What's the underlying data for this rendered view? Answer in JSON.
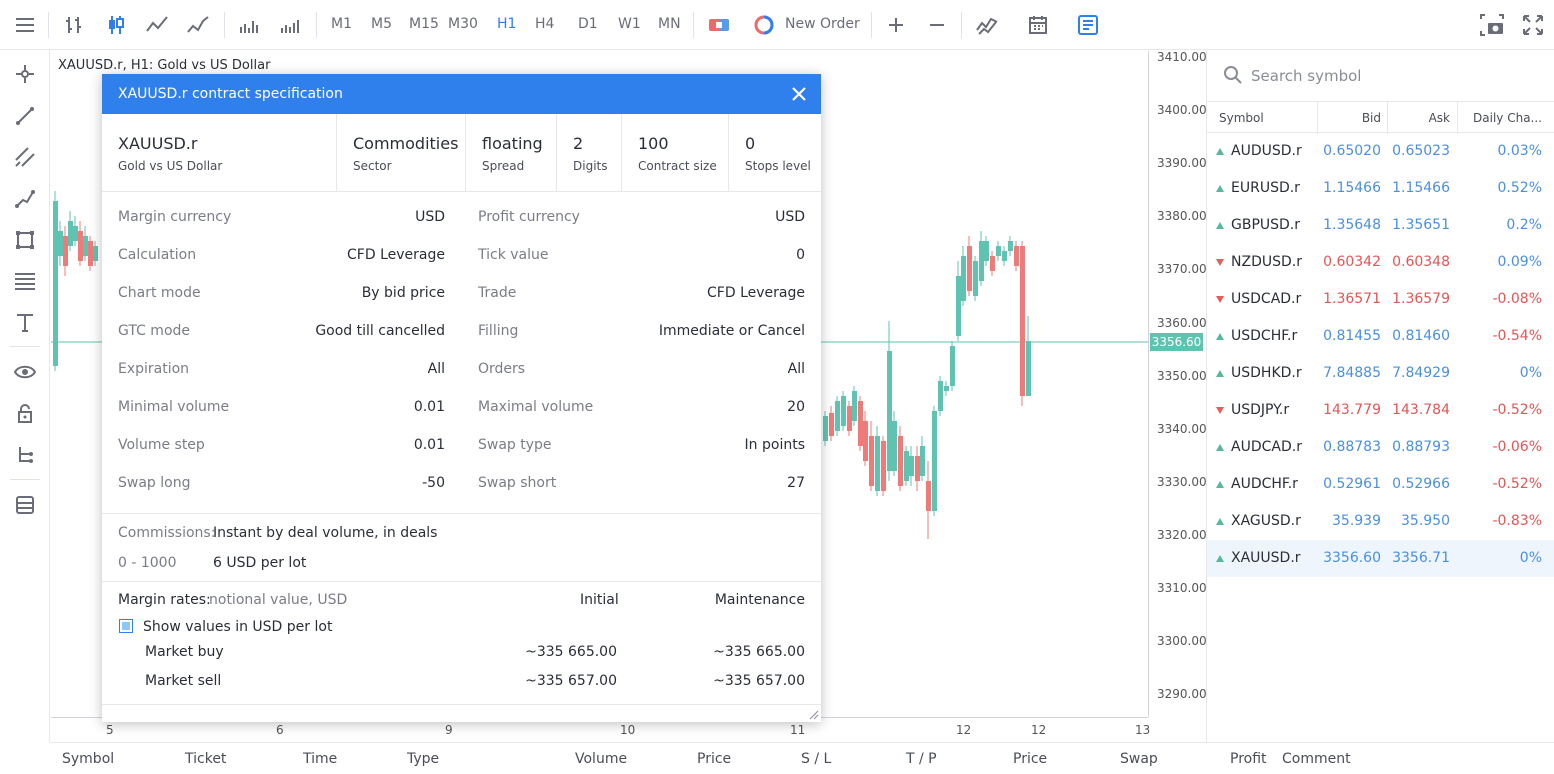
{
  "toolbar": {
    "timeframes": [
      "M1",
      "M5",
      "M15",
      "M30",
      "H1",
      "H4",
      "D1",
      "W1",
      "MN"
    ],
    "active_timeframe": "H1",
    "new_order_label": "New Order"
  },
  "chart": {
    "title": "XAUUSD.r, H1: Gold vs US Dollar",
    "price_labels": [
      "3410.00",
      "3400.00",
      "3390.00",
      "3380.00",
      "3370.00",
      "3360.00",
      "3350.00",
      "3340.00",
      "3330.00",
      "3320.00",
      "3310.00",
      "3300.00",
      "3290.00"
    ],
    "current_price": "3356.60",
    "time_labels": [
      "5",
      "6",
      "9",
      "10",
      "11",
      "12",
      "12",
      "13"
    ],
    "colors": {
      "up": "#5fc3b2",
      "down": "#ef7a7a"
    }
  },
  "symbols_panel": {
    "search_placeholder": "Search symbol",
    "columns": {
      "symbol": "Symbol",
      "bid": "Bid",
      "ask": "Ask",
      "change": "Daily Cha..."
    },
    "rows": [
      {
        "symbol": "AUDUSD.r",
        "bid": "0.65020",
        "ask": "0.65023",
        "change": "0.03%",
        "dir": "up"
      },
      {
        "symbol": "EURUSD.r",
        "bid": "1.15466",
        "ask": "1.15466",
        "change": "0.52%",
        "dir": "up"
      },
      {
        "symbol": "GBPUSD.r",
        "bid": "1.35648",
        "ask": "1.35651",
        "change": "0.2%",
        "dir": "up"
      },
      {
        "symbol": "NZDUSD.r",
        "bid": "0.60342",
        "ask": "0.60348",
        "change": "0.09%",
        "dir": "down"
      },
      {
        "symbol": "USDCAD.r",
        "bid": "1.36571",
        "ask": "1.36579",
        "change": "-0.08%",
        "dir": "down"
      },
      {
        "symbol": "USDCHF.r",
        "bid": "0.81455",
        "ask": "0.81460",
        "change": "-0.54%",
        "dir": "up"
      },
      {
        "symbol": "USDHKD.r",
        "bid": "7.84885",
        "ask": "7.84929",
        "change": "0%",
        "dir": "up"
      },
      {
        "symbol": "USDJPY.r",
        "bid": "143.779",
        "ask": "143.784",
        "change": "-0.52%",
        "dir": "down"
      },
      {
        "symbol": "AUDCAD.r",
        "bid": "0.88783",
        "ask": "0.88793",
        "change": "-0.06%",
        "dir": "up"
      },
      {
        "symbol": "AUDCHF.r",
        "bid": "0.52961",
        "ask": "0.52966",
        "change": "-0.52%",
        "dir": "up"
      },
      {
        "symbol": "XAGUSD.r",
        "bid": "35.939",
        "ask": "35.950",
        "change": "-0.83%",
        "dir": "up"
      },
      {
        "symbol": "XAUUSD.r",
        "bid": "3356.60",
        "ask": "3356.71",
        "change": "0%",
        "dir": "up",
        "selected": true
      }
    ]
  },
  "trade_table": {
    "columns": [
      "Symbol",
      "Ticket",
      "Time",
      "Type",
      "Volume",
      "Price",
      "S / L",
      "T / P",
      "Price",
      "Swap",
      "Profit",
      "Comment"
    ]
  },
  "dialog": {
    "title": "XAUUSD.r contract specification",
    "summary": [
      {
        "main": "XAUUSD.r",
        "sub": "Gold vs US Dollar"
      },
      {
        "main": "Commodities",
        "sub": "Sector"
      },
      {
        "main": "floating",
        "sub": "Spread"
      },
      {
        "main": "2",
        "sub": "Digits"
      },
      {
        "main": "100",
        "sub": "Contract size"
      },
      {
        "main": "0",
        "sub": "Stops level"
      }
    ],
    "left_props": [
      {
        "label": "Margin currency",
        "value": "USD"
      },
      {
        "label": "Calculation",
        "value": "CFD Leverage"
      },
      {
        "label": "Chart mode",
        "value": "By bid price"
      },
      {
        "label": "GTC mode",
        "value": "Good till cancelled"
      },
      {
        "label": "Expiration",
        "value": "All"
      },
      {
        "label": "Minimal volume",
        "value": "0.01"
      },
      {
        "label": "Volume step",
        "value": "0.01"
      },
      {
        "label": "Swap long",
        "value": "-50"
      }
    ],
    "right_props": [
      {
        "label": "Profit currency",
        "value": "USD"
      },
      {
        "label": "Tick value",
        "value": "0"
      },
      {
        "label": "Trade",
        "value": "CFD Leverage"
      },
      {
        "label": "Filling",
        "value": "Immediate or Cancel"
      },
      {
        "label": "Orders",
        "value": "All"
      },
      {
        "label": "Maximal volume",
        "value": "20"
      },
      {
        "label": "Swap type",
        "value": "In points"
      },
      {
        "label": "Swap short",
        "value": "27"
      }
    ],
    "commissions": {
      "label": "Commissions:",
      "value": "Instant by deal volume, in deals",
      "range": "0 - 1000",
      "fee": "6 USD per lot"
    },
    "margin_rates": {
      "label": "Margin rates:",
      "sub": "notional value, USD",
      "initial_header": "Initial",
      "maintenance_header": "Maintenance",
      "checkbox_label": "Show values in USD per lot",
      "checkbox_checked": true,
      "rows": [
        {
          "name": "Market buy",
          "initial": "~335 665.00",
          "maintenance": "~335 665.00"
        },
        {
          "name": "Market sell",
          "initial": "~335 657.00",
          "maintenance": "~335 657.00"
        }
      ]
    }
  }
}
